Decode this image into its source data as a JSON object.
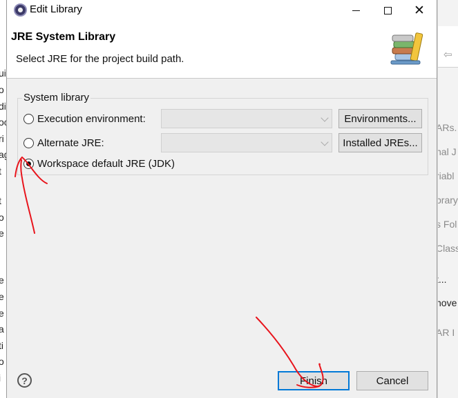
{
  "background": {
    "left_fragments": [
      "ui",
      "o",
      "di",
      "oc",
      "ri",
      "ag",
      "t",
      "t",
      "o",
      "e",
      "e",
      "e",
      "e",
      "a",
      "ti",
      "o",
      "i"
    ],
    "right_fragments": [
      "ARs.",
      "nal J",
      "riabl",
      "brary",
      "s Fol",
      "Class",
      "t...",
      "nove",
      "AR I"
    ]
  },
  "dialog": {
    "window_title": "Edit Library",
    "header_title": "JRE System Library",
    "header_description": "Select JRE for the project build path.",
    "group_label": "System library",
    "options": [
      {
        "label": "Execution environment:",
        "checked": false,
        "button": "Environments..."
      },
      {
        "label": "Alternate JRE:",
        "checked": false,
        "button": "Installed JREs..."
      },
      {
        "label": "Workspace default JRE (JDK)",
        "checked": true
      }
    ],
    "footer": {
      "help_symbol": "?",
      "finish_label": "Finish",
      "cancel_label": "Cancel"
    }
  },
  "colors": {
    "annotation": "#e8141c",
    "focus_border": "#0078d7"
  }
}
